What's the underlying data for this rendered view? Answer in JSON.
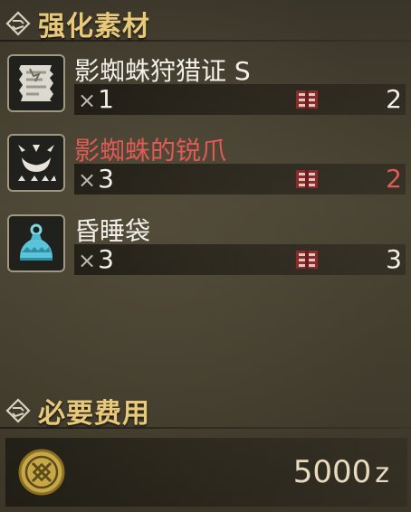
{
  "materials_section": {
    "title": "强化素材"
  },
  "items": [
    {
      "name": "影蜘蛛狩猎证 S",
      "times": "×",
      "required": "1",
      "owned": "2",
      "icon": "ticket-icon",
      "name_color": "#f2f0ea",
      "owned_color": "#f2f0ea"
    },
    {
      "name": "影蜘蛛的锐爪",
      "times": "×",
      "required": "3",
      "owned": "2",
      "icon": "claw-icon",
      "name_color": "#e05b56",
      "owned_color": "#e05b56"
    },
    {
      "name": "昏睡袋",
      "times": "×",
      "required": "3",
      "owned": "3",
      "icon": "sleep-sac-icon",
      "name_color": "#f2f0ea",
      "owned_color": "#f2f0ea"
    }
  ],
  "cost_section": {
    "title": "必要费用"
  },
  "cost": {
    "value": "5000",
    "unit": "z",
    "icon": "zenny-coin-icon"
  }
}
